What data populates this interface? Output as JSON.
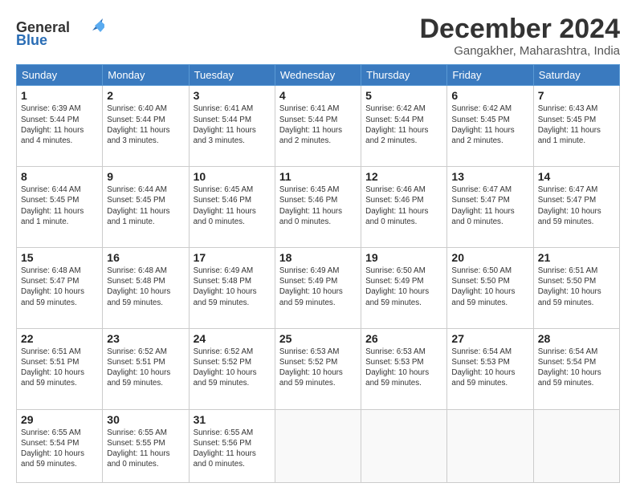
{
  "header": {
    "logo_general": "General",
    "logo_blue": "Blue",
    "title": "December 2024",
    "location": "Gangakher, Maharashtra, India"
  },
  "days_of_week": [
    "Sunday",
    "Monday",
    "Tuesday",
    "Wednesday",
    "Thursday",
    "Friday",
    "Saturday"
  ],
  "weeks": [
    [
      {
        "day": 1,
        "info": "Sunrise: 6:39 AM\nSunset: 5:44 PM\nDaylight: 11 hours\nand 4 minutes."
      },
      {
        "day": 2,
        "info": "Sunrise: 6:40 AM\nSunset: 5:44 PM\nDaylight: 11 hours\nand 3 minutes."
      },
      {
        "day": 3,
        "info": "Sunrise: 6:41 AM\nSunset: 5:44 PM\nDaylight: 11 hours\nand 3 minutes."
      },
      {
        "day": 4,
        "info": "Sunrise: 6:41 AM\nSunset: 5:44 PM\nDaylight: 11 hours\nand 2 minutes."
      },
      {
        "day": 5,
        "info": "Sunrise: 6:42 AM\nSunset: 5:44 PM\nDaylight: 11 hours\nand 2 minutes."
      },
      {
        "day": 6,
        "info": "Sunrise: 6:42 AM\nSunset: 5:45 PM\nDaylight: 11 hours\nand 2 minutes."
      },
      {
        "day": 7,
        "info": "Sunrise: 6:43 AM\nSunset: 5:45 PM\nDaylight: 11 hours\nand 1 minute."
      }
    ],
    [
      {
        "day": 8,
        "info": "Sunrise: 6:44 AM\nSunset: 5:45 PM\nDaylight: 11 hours\nand 1 minute."
      },
      {
        "day": 9,
        "info": "Sunrise: 6:44 AM\nSunset: 5:45 PM\nDaylight: 11 hours\nand 1 minute."
      },
      {
        "day": 10,
        "info": "Sunrise: 6:45 AM\nSunset: 5:46 PM\nDaylight: 11 hours\nand 0 minutes."
      },
      {
        "day": 11,
        "info": "Sunrise: 6:45 AM\nSunset: 5:46 PM\nDaylight: 11 hours\nand 0 minutes."
      },
      {
        "day": 12,
        "info": "Sunrise: 6:46 AM\nSunset: 5:46 PM\nDaylight: 11 hours\nand 0 minutes."
      },
      {
        "day": 13,
        "info": "Sunrise: 6:47 AM\nSunset: 5:47 PM\nDaylight: 11 hours\nand 0 minutes."
      },
      {
        "day": 14,
        "info": "Sunrise: 6:47 AM\nSunset: 5:47 PM\nDaylight: 10 hours\nand 59 minutes."
      }
    ],
    [
      {
        "day": 15,
        "info": "Sunrise: 6:48 AM\nSunset: 5:47 PM\nDaylight: 10 hours\nand 59 minutes."
      },
      {
        "day": 16,
        "info": "Sunrise: 6:48 AM\nSunset: 5:48 PM\nDaylight: 10 hours\nand 59 minutes."
      },
      {
        "day": 17,
        "info": "Sunrise: 6:49 AM\nSunset: 5:48 PM\nDaylight: 10 hours\nand 59 minutes."
      },
      {
        "day": 18,
        "info": "Sunrise: 6:49 AM\nSunset: 5:49 PM\nDaylight: 10 hours\nand 59 minutes."
      },
      {
        "day": 19,
        "info": "Sunrise: 6:50 AM\nSunset: 5:49 PM\nDaylight: 10 hours\nand 59 minutes."
      },
      {
        "day": 20,
        "info": "Sunrise: 6:50 AM\nSunset: 5:50 PM\nDaylight: 10 hours\nand 59 minutes."
      },
      {
        "day": 21,
        "info": "Sunrise: 6:51 AM\nSunset: 5:50 PM\nDaylight: 10 hours\nand 59 minutes."
      }
    ],
    [
      {
        "day": 22,
        "info": "Sunrise: 6:51 AM\nSunset: 5:51 PM\nDaylight: 10 hours\nand 59 minutes."
      },
      {
        "day": 23,
        "info": "Sunrise: 6:52 AM\nSunset: 5:51 PM\nDaylight: 10 hours\nand 59 minutes."
      },
      {
        "day": 24,
        "info": "Sunrise: 6:52 AM\nSunset: 5:52 PM\nDaylight: 10 hours\nand 59 minutes."
      },
      {
        "day": 25,
        "info": "Sunrise: 6:53 AM\nSunset: 5:52 PM\nDaylight: 10 hours\nand 59 minutes."
      },
      {
        "day": 26,
        "info": "Sunrise: 6:53 AM\nSunset: 5:53 PM\nDaylight: 10 hours\nand 59 minutes."
      },
      {
        "day": 27,
        "info": "Sunrise: 6:54 AM\nSunset: 5:53 PM\nDaylight: 10 hours\nand 59 minutes."
      },
      {
        "day": 28,
        "info": "Sunrise: 6:54 AM\nSunset: 5:54 PM\nDaylight: 10 hours\nand 59 minutes."
      }
    ],
    [
      {
        "day": 29,
        "info": "Sunrise: 6:55 AM\nSunset: 5:54 PM\nDaylight: 10 hours\nand 59 minutes."
      },
      {
        "day": 30,
        "info": "Sunrise: 6:55 AM\nSunset: 5:55 PM\nDaylight: 11 hours\nand 0 minutes."
      },
      {
        "day": 31,
        "info": "Sunrise: 6:55 AM\nSunset: 5:56 PM\nDaylight: 11 hours\nand 0 minutes."
      },
      null,
      null,
      null,
      null
    ]
  ]
}
